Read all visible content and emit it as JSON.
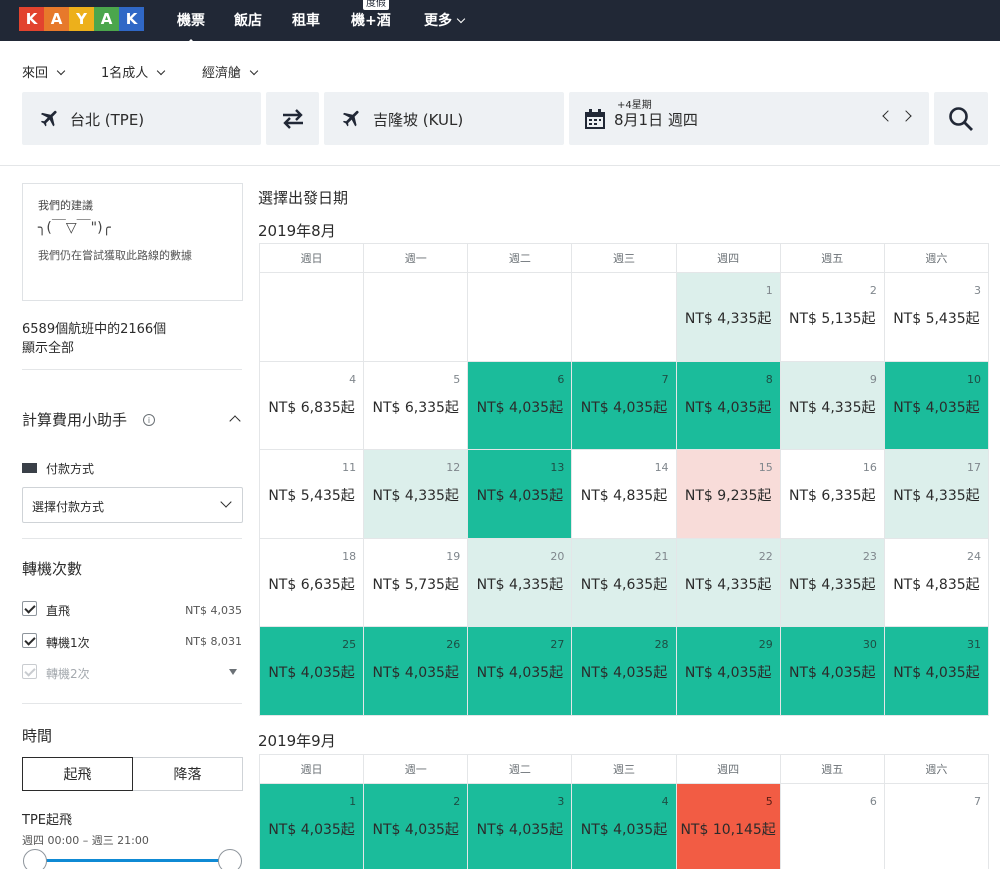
{
  "nav": {
    "logo_letters": [
      "K",
      "A",
      "Y",
      "A",
      "K"
    ],
    "logo_colors": [
      "#e2432e",
      "#e7792b",
      "#edb01b",
      "#4ba64c",
      "#3068c6"
    ],
    "links": [
      "機票",
      "飯店",
      "租車",
      "機+酒",
      "更多"
    ],
    "badge": "度假",
    "background": "#212836"
  },
  "options": {
    "trip_type": "來回",
    "travelers": "1名成人",
    "cabin": "經濟艙"
  },
  "search": {
    "origin": "台北 (TPE)",
    "destination": "吉隆坡 (KUL)",
    "date_hint": "+4星期",
    "date": "8月1日 週四",
    "swap_icon": "swap-arrows-icon",
    "search_icon": "search-icon"
  },
  "sidebar": {
    "suggest_title": "我們的建議",
    "suggest_face": "╮(￣▽￣\")╭",
    "suggest_msg": "我們仍在嘗試獲取此路線的數據",
    "count_text": "6589個航班中的2166個",
    "show_all": "顯示全部",
    "fee_helper_title": "計算費用小助手",
    "payment_label": "付款方式",
    "payment_placeholder": "選擇付款方式",
    "stops_title": "轉機次數",
    "stops": [
      {
        "label": "直飛",
        "price": "NT$ 4,035",
        "checked": true
      },
      {
        "label": "轉機1次",
        "price": "NT$ 8,031",
        "checked": true
      },
      {
        "label": "轉機2次",
        "price": "",
        "checked": false
      }
    ],
    "time_title": "時間",
    "toggle_depart": "起飛",
    "toggle_arrive": "降落",
    "depart_label": "TPE起飛",
    "depart_range": "週四 00:00 – 週三 21:00"
  },
  "calendar": {
    "heading": "選擇出發日期",
    "weekdays": [
      "週日",
      "週一",
      "週二",
      "週三",
      "週四",
      "週五",
      "週六"
    ],
    "months": [
      {
        "title": "2019年8月",
        "lead_blanks": 4,
        "days": [
          {
            "d": "1",
            "p": "NT$ 4,335起",
            "lvl": "mid"
          },
          {
            "d": "2",
            "p": "NT$ 5,135起",
            "lvl": "none"
          },
          {
            "d": "3",
            "p": "NT$ 5,435起",
            "lvl": "none"
          },
          {
            "d": "4",
            "p": "NT$ 6,835起",
            "lvl": "none"
          },
          {
            "d": "5",
            "p": "NT$ 6,335起",
            "lvl": "none"
          },
          {
            "d": "6",
            "p": "NT$ 4,035起",
            "lvl": "low"
          },
          {
            "d": "7",
            "p": "NT$ 4,035起",
            "lvl": "low"
          },
          {
            "d": "8",
            "p": "NT$ 4,035起",
            "lvl": "low"
          },
          {
            "d": "9",
            "p": "NT$ 4,335起",
            "lvl": "mid"
          },
          {
            "d": "10",
            "p": "NT$ 4,035起",
            "lvl": "low"
          },
          {
            "d": "11",
            "p": "NT$ 5,435起",
            "lvl": "none"
          },
          {
            "d": "12",
            "p": "NT$ 4,335起",
            "lvl": "mid"
          },
          {
            "d": "13",
            "p": "NT$ 4,035起",
            "lvl": "low"
          },
          {
            "d": "14",
            "p": "NT$ 4,835起",
            "lvl": "none"
          },
          {
            "d": "15",
            "p": "NT$ 9,235起",
            "lvl": "high"
          },
          {
            "d": "16",
            "p": "NT$ 6,335起",
            "lvl": "none"
          },
          {
            "d": "17",
            "p": "NT$ 4,335起",
            "lvl": "mid"
          },
          {
            "d": "18",
            "p": "NT$ 6,635起",
            "lvl": "none"
          },
          {
            "d": "19",
            "p": "NT$ 5,735起",
            "lvl": "none"
          },
          {
            "d": "20",
            "p": "NT$ 4,335起",
            "lvl": "mid"
          },
          {
            "d": "21",
            "p": "NT$ 4,635起",
            "lvl": "mid"
          },
          {
            "d": "22",
            "p": "NT$ 4,335起",
            "lvl": "mid"
          },
          {
            "d": "23",
            "p": "NT$ 4,335起",
            "lvl": "mid"
          },
          {
            "d": "24",
            "p": "NT$ 4,835起",
            "lvl": "none"
          },
          {
            "d": "25",
            "p": "NT$ 4,035起",
            "lvl": "low"
          },
          {
            "d": "26",
            "p": "NT$ 4,035起",
            "lvl": "low"
          },
          {
            "d": "27",
            "p": "NT$ 4,035起",
            "lvl": "low"
          },
          {
            "d": "28",
            "p": "NT$ 4,035起",
            "lvl": "low"
          },
          {
            "d": "29",
            "p": "NT$ 4,035起",
            "lvl": "low"
          },
          {
            "d": "30",
            "p": "NT$ 4,035起",
            "lvl": "low"
          },
          {
            "d": "31",
            "p": "NT$ 4,035起",
            "lvl": "low"
          }
        ]
      },
      {
        "title": "2019年9月",
        "lead_blanks": 0,
        "days": [
          {
            "d": "1",
            "p": "NT$ 4,035起",
            "lvl": "low"
          },
          {
            "d": "2",
            "p": "NT$ 4,035起",
            "lvl": "low"
          },
          {
            "d": "3",
            "p": "NT$ 4,035起",
            "lvl": "low"
          },
          {
            "d": "4",
            "p": "NT$ 4,035起",
            "lvl": "low"
          },
          {
            "d": "5",
            "p": "NT$ 10,145起",
            "lvl": "max"
          },
          {
            "d": "6",
            "p": "",
            "lvl": "none"
          },
          {
            "d": "7",
            "p": "",
            "lvl": "none"
          }
        ]
      }
    ]
  }
}
